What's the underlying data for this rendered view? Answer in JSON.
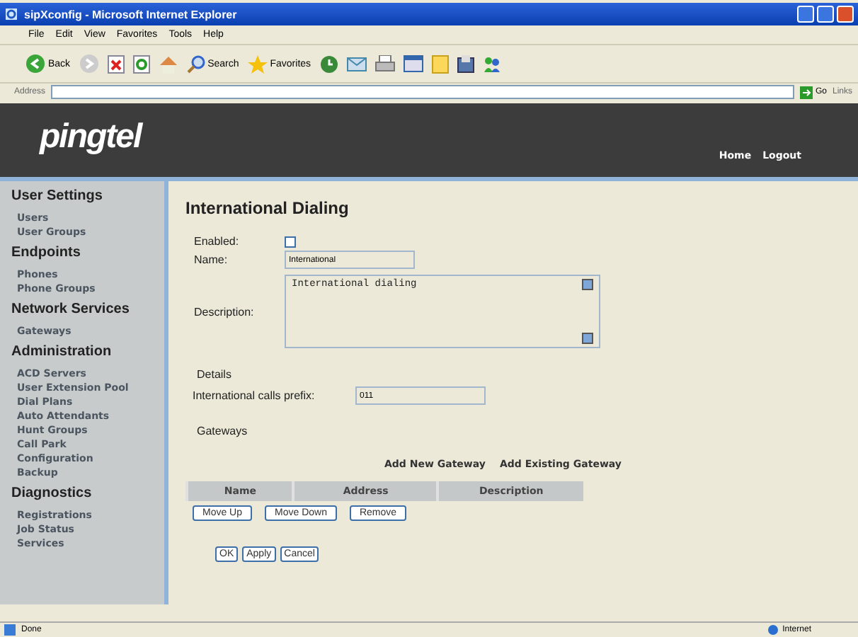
{
  "window": {
    "title": "sipXconfig - Microsoft Internet Explorer"
  },
  "menu": [
    "File",
    "Edit",
    "View",
    "Favorites",
    "Tools",
    "Help"
  ],
  "toolbar": {
    "back": "Back",
    "search": "Search",
    "favorites": "Favorites"
  },
  "address_bar": {
    "label": "Address",
    "go": "Go",
    "links": "Links"
  },
  "banner": {
    "logo": "pingtel",
    "links": [
      "Home",
      "Logout"
    ]
  },
  "sidebar": [
    {
      "heading": "User Settings",
      "items": [
        "Users",
        "User Groups"
      ]
    },
    {
      "heading": "Endpoints",
      "items": [
        "Phones",
        "Phone Groups"
      ]
    },
    {
      "heading": "Network Services",
      "items": [
        "Gateways"
      ]
    },
    {
      "heading": "Administration",
      "items": [
        "ACD Servers",
        "User Extension Pool",
        "Dial Plans",
        "Auto Attendants",
        "Hunt Groups",
        "Call Park",
        "Configuration",
        "Backup"
      ]
    },
    {
      "heading": "Diagnostics",
      "items": [
        "Registrations",
        "Job Status",
        "Services"
      ]
    }
  ],
  "page": {
    "title": "International Dialing",
    "enabled": {
      "label": "Enabled:",
      "checked": false
    },
    "name": {
      "label": "Name:",
      "value": "International"
    },
    "description": {
      "label": "Description:",
      "value": "International dialing"
    },
    "details": {
      "heading": "Details",
      "prefix_label": "International calls prefix:",
      "prefix_value": "011"
    },
    "gateways": {
      "heading": "Gateways",
      "actions": [
        "Add New Gateway",
        "Add Existing Gateway"
      ],
      "columns": [
        "Name",
        "Address",
        "Description"
      ],
      "buttons": [
        "Move Up",
        "Move Down",
        "Remove"
      ]
    },
    "buttons": [
      "OK",
      "Apply",
      "Cancel"
    ]
  },
  "status_bar": {
    "text": "Done",
    "zone": "Internet"
  }
}
